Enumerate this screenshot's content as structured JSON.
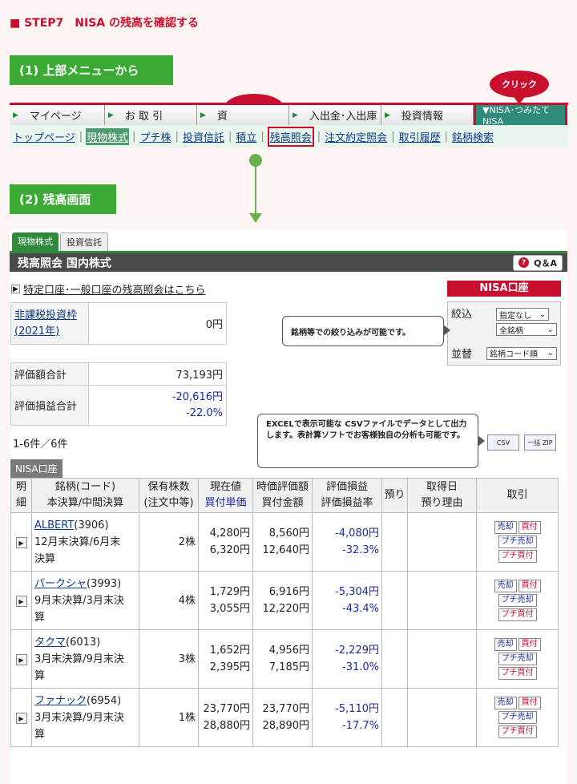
{
  "step_title": "■ STEP7　NISA の残高を確認する",
  "section1": "(1) 上部メニューから",
  "section2": "(2) 残高画面",
  "click_label": "クリック",
  "menu": [
    "マイページ",
    "お 取 引",
    "資",
    "入出金･入出庫",
    "投資情報"
  ],
  "nisa_menu": "▼NISA･つみたてNISA",
  "submenu": [
    "トップページ",
    "現物株式",
    "プチ株",
    "投資信託",
    "積立",
    "残高照会",
    "注文約定照会",
    "取引履歴",
    "銘柄検索"
  ],
  "tabs": [
    "現物株式",
    "投資信託"
  ],
  "panel_title": "残高照会 国内株式",
  "qa": "Q＆A",
  "special_link": "特定口座･一般口座の残高照会はこちら",
  "nisa_account": "NISA口座",
  "tax_free_label": "非課税投資枠(2021年)",
  "tax_free_value": "0円",
  "eval_total_label": "評価額合計",
  "eval_total_value": "73,193円",
  "pl_total_label": "評価損益合計",
  "pl_total_value": "-20,616円",
  "pl_total_rate": "-22.0%",
  "callout_filter": "銘柄等での絞り込みが可能です。",
  "filter_label": "絞込",
  "filter_sel1": "指定なし",
  "filter_sel2": "全銘柄",
  "sort_label": "並替",
  "sort_sel": "銘柄コード順",
  "callout_csv": "EXCELで表示可能な CSVファイルでデータとして出力します。表計算ソフトでお客様独自の分析も可能です。",
  "csv_label": "CSV",
  "zip_label": "一括 ZIP",
  "count_text": "1-6件／6件",
  "nisa_tag": "NISA口座",
  "headers": {
    "h1a": "明",
    "h1b": "細",
    "h2a": "銘柄(コード)",
    "h2b": "本決算/中間決算",
    "h3a": "保有株数",
    "h3b": "(注文中等)",
    "h4a": "現在値",
    "h4b": "買付単価",
    "h5a": "時価評価額",
    "h5b": "買付金額",
    "h6a": "評価損益",
    "h6b": "評価損益率",
    "h7": "預り",
    "h8a": "取得日",
    "h8b": "預り理由",
    "h9": "取引"
  },
  "rows": [
    {
      "name": "ALBERT",
      "code": "(3906)",
      "period1": "12月末決算/6月末",
      "period2": "決算",
      "shares": "2株",
      "price": "4,280円",
      "buy_price": "6,320円",
      "value": "8,560円",
      "cost": "12,640円",
      "pl": "-4,080円",
      "rate": "-32.3%"
    },
    {
      "name": "パークシャ",
      "code": "(3993)",
      "period1": "9月末決算/3月末決",
      "period2": "算",
      "shares": "4株",
      "price": "1,729円",
      "buy_price": "3,055円",
      "value": "6,916円",
      "cost": "12,220円",
      "pl": "-5,304円",
      "rate": "-43.4%"
    },
    {
      "name": "タクマ",
      "code": "(6013)",
      "period1": "3月末決算/9月末決",
      "period2": "算",
      "shares": "3株",
      "price": "1,652円",
      "buy_price": "2,395円",
      "value": "4,956円",
      "cost": "7,185円",
      "pl": "-2,229円",
      "rate": "-31.0%"
    },
    {
      "name": "ファナック",
      "code": "(6954)",
      "period1": "3月末決算/9月末決",
      "period2": "算",
      "shares": "1株",
      "price": "23,770円",
      "buy_price": "28,880円",
      "value": "23,770円",
      "cost": "28,890円",
      "pl": "-5,110円",
      "rate": "-17.7%"
    }
  ],
  "trade_buttons": {
    "sell": "売却",
    "buy": "買付",
    "petit_sell": "プチ売却",
    "petit_buy": "プチ買付"
  },
  "colors": {
    "red": "#c8102e",
    "green": "#3aaa35",
    "header_dark": "#4a4a4a",
    "nisa_teal": "#2e8b7a"
  }
}
